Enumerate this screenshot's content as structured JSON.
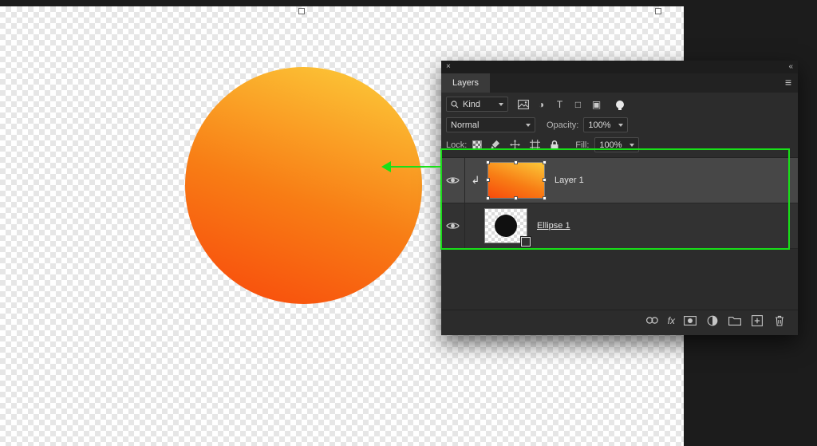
{
  "annotation": {
    "green": "#18E018"
  },
  "canvas": {
    "gradient": {
      "top": "#FCC838",
      "mid": "#F87D15",
      "bottom": "#F84A0C"
    },
    "checker_light": "#FFFFFF",
    "checker_dark": "#E6E6E6"
  },
  "icons": {
    "close": "×",
    "collapse": "«",
    "menu": "≡",
    "adjustment_filter": "◑",
    "type_filter": "T",
    "shape_filter": "□",
    "smart_filter": "▣",
    "clip": "↲",
    "fx": "fx"
  },
  "panel": {
    "tab": "Layers",
    "filter": {
      "kind": "Kind"
    },
    "blend": {
      "mode": "Normal",
      "opacity_label": "Opacity:",
      "opacity_value": "100%"
    },
    "lock": {
      "label": "Lock:",
      "fill_label": "Fill:",
      "fill_value": "100%"
    },
    "layers": [
      {
        "name": "Layer 1",
        "selected": true,
        "clipped": true,
        "visible": true
      },
      {
        "name": "Ellipse 1",
        "selected": false,
        "clipped": false,
        "visible": true
      }
    ]
  }
}
